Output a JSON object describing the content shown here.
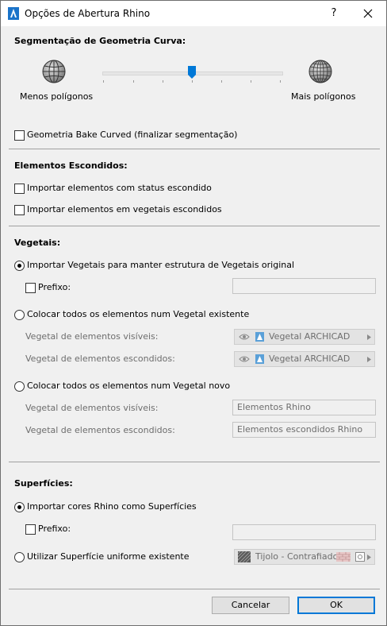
{
  "window": {
    "title": "Opções de Abertura Rhino",
    "help": "?"
  },
  "segmentation": {
    "heading": "Segmentação de Geometria Curva:",
    "less_label": "Menos polígonos",
    "more_label": "Mais polígonos",
    "slider_value": 0.5,
    "bake_curved": {
      "label": "Geometria Bake Curved (finalizar segmentação)",
      "checked": false
    }
  },
  "hidden": {
    "heading": "Elementos Escondidos:",
    "import_hidden": {
      "label": "Importar elementos com status escondido",
      "checked": false
    },
    "import_in_hidden_layers": {
      "label": "Importar elementos em vegetais escondidos",
      "checked": false
    }
  },
  "layers": {
    "heading": "Vegetais:",
    "opt_keep": {
      "label": "Importar Vegetais para manter estrutura de Vegetais original",
      "selected": true
    },
    "prefix_label": "Prefixo:",
    "prefix_value": "",
    "opt_existing": {
      "label": "Colocar todos os elementos num Vegetal existente",
      "selected": false
    },
    "visible_label": "Vegetal de elementos visíveis:",
    "hidden_label": "Vegetal de elementos escondidos:",
    "existing_visible_value": "Vegetal ARCHICAD",
    "existing_hidden_value": "Vegetal ARCHICAD",
    "opt_new": {
      "label": "Colocar todos os elementos num Vegetal novo",
      "selected": false
    },
    "new_visible_value": "Elementos Rhino",
    "new_hidden_value": "Elementos escondidos Rhino"
  },
  "surfaces": {
    "heading": "Superfícies:",
    "opt_import": {
      "label": "Importar cores Rhino como Superfícies",
      "selected": true
    },
    "prefix_label": "Prefixo:",
    "prefix_value": "",
    "opt_uniform": {
      "label": "Utilizar Superfície uniforme existente",
      "selected": false
    },
    "uniform_value": "Tijolo - Contrafiado"
  },
  "buttons": {
    "cancel": "Cancelar",
    "ok": "OK"
  }
}
